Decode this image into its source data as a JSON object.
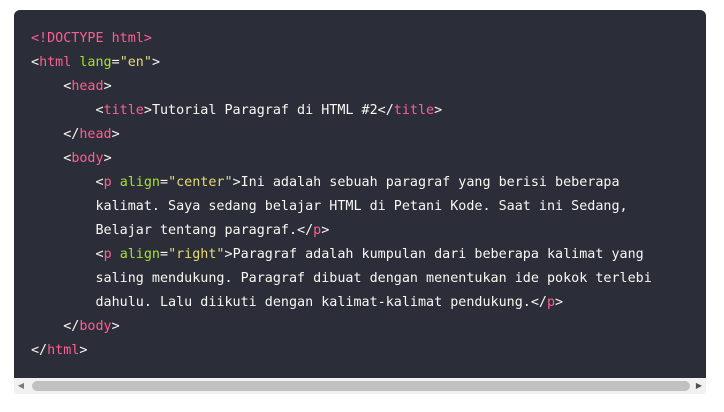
{
  "code": {
    "lines": [
      [
        {
          "t": "doctype",
          "v": "<!DOCTYPE html>"
        }
      ],
      [
        {
          "t": "punc",
          "v": "<"
        },
        {
          "t": "tag",
          "v": "html"
        },
        {
          "t": "punc",
          "v": " "
        },
        {
          "t": "attr",
          "v": "lang"
        },
        {
          "t": "punc",
          "v": "="
        },
        {
          "t": "val",
          "v": "\"en\""
        },
        {
          "t": "punc",
          "v": ">"
        }
      ],
      [
        {
          "t": "punc",
          "v": "    <"
        },
        {
          "t": "tag",
          "v": "head"
        },
        {
          "t": "punc",
          "v": ">"
        }
      ],
      [
        {
          "t": "punc",
          "v": "        <"
        },
        {
          "t": "tag",
          "v": "title"
        },
        {
          "t": "punc",
          "v": ">"
        },
        {
          "t": "txt",
          "v": "Tutorial Paragraf di HTML #2"
        },
        {
          "t": "punc",
          "v": "</"
        },
        {
          "t": "tag",
          "v": "title"
        },
        {
          "t": "punc",
          "v": ">"
        }
      ],
      [
        {
          "t": "punc",
          "v": "    </"
        },
        {
          "t": "tag",
          "v": "head"
        },
        {
          "t": "punc",
          "v": ">"
        }
      ],
      [
        {
          "t": "punc",
          "v": "    <"
        },
        {
          "t": "tag",
          "v": "body"
        },
        {
          "t": "punc",
          "v": ">"
        }
      ],
      [
        {
          "t": "punc",
          "v": "        <"
        },
        {
          "t": "tag",
          "v": "p"
        },
        {
          "t": "punc",
          "v": " "
        },
        {
          "t": "attr",
          "v": "align"
        },
        {
          "t": "punc",
          "v": "="
        },
        {
          "t": "val",
          "v": "\"center\""
        },
        {
          "t": "punc",
          "v": ">"
        },
        {
          "t": "txt",
          "v": "Ini adalah sebuah paragraf yang berisi beberapa"
        }
      ],
      [
        {
          "t": "txt",
          "v": "        kalimat. Saya sedang belajar HTML di Petani Kode. Saat ini Sedang,"
        }
      ],
      [
        {
          "t": "txt",
          "v": "        Belajar tentang paragraf."
        },
        {
          "t": "punc",
          "v": "</"
        },
        {
          "t": "tag",
          "v": "p"
        },
        {
          "t": "punc",
          "v": ">"
        }
      ],
      [
        {
          "t": "punc",
          "v": "        <"
        },
        {
          "t": "tag",
          "v": "p"
        },
        {
          "t": "punc",
          "v": " "
        },
        {
          "t": "attr",
          "v": "align"
        },
        {
          "t": "punc",
          "v": "="
        },
        {
          "t": "val",
          "v": "\"right\""
        },
        {
          "t": "punc",
          "v": ">"
        },
        {
          "t": "txt",
          "v": "Paragraf adalah kumpulan dari beberapa kalimat yang"
        }
      ],
      [
        {
          "t": "txt",
          "v": "        saling mendukung. Paragraf dibuat dengan menentukan ide pokok terlebi"
        }
      ],
      [
        {
          "t": "txt",
          "v": "        dahulu. Lalu diikuti dengan kalimat-kalimat pendukung."
        },
        {
          "t": "punc",
          "v": "</"
        },
        {
          "t": "tag",
          "v": "p"
        },
        {
          "t": "punc",
          "v": ">"
        }
      ],
      [
        {
          "t": "punc",
          "v": "    </"
        },
        {
          "t": "tag",
          "v": "body"
        },
        {
          "t": "punc",
          "v": ">"
        }
      ],
      [
        {
          "t": "punc",
          "v": "</"
        },
        {
          "t": "tag",
          "v": "html"
        },
        {
          "t": "punc",
          "v": ">"
        }
      ]
    ]
  },
  "scrollbar": {
    "left_arrow": "◀",
    "right_arrow": "▶"
  },
  "colors": {
    "background": "#2b2d39",
    "tag": "#ff5f8f",
    "attribute": "#a6e22e",
    "value": "#e6db74",
    "text": "#f8f8f2"
  }
}
